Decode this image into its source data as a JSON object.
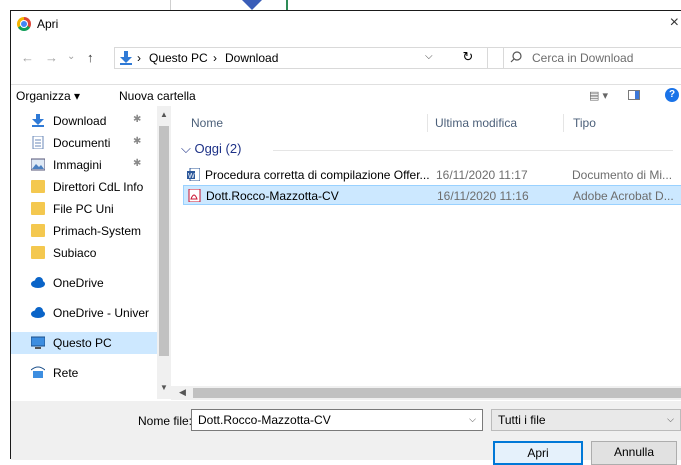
{
  "dialog": {
    "title": "Apri",
    "close_glyph": "×"
  },
  "nav": {
    "back": "←",
    "forward": "→",
    "recent": "⌄",
    "up": "↑",
    "breadcrumb": [
      "Questo PC",
      "Download"
    ],
    "separator": "›",
    "refresh": "↻",
    "search_placeholder": "Cerca in Download"
  },
  "toolbar": {
    "organize": "Organizza ▾",
    "new_folder": "Nuova cartella",
    "views": "▤ ▾",
    "help": "?"
  },
  "navpane": {
    "items": [
      {
        "label": "Download",
        "icon": "download-icon",
        "pinned": true
      },
      {
        "label": "Documenti",
        "icon": "document-icon",
        "pinned": true
      },
      {
        "label": "Immagini",
        "icon": "image-icon",
        "pinned": true
      },
      {
        "label": "Direttori CdL Info",
        "icon": "folder-icon",
        "pinned": false
      },
      {
        "label": "File PC Uni",
        "icon": "folder-icon",
        "pinned": false
      },
      {
        "label": "Primach-System",
        "icon": "folder-icon",
        "pinned": false
      },
      {
        "label": "Subiaco",
        "icon": "folder-icon",
        "pinned": false
      },
      {
        "label": "OneDrive",
        "icon": "cloud-icon",
        "pinned": false
      },
      {
        "label": "OneDrive - Univer",
        "icon": "cloud-icon",
        "pinned": false
      },
      {
        "label": "Questo PC",
        "icon": "computer-icon",
        "pinned": false
      },
      {
        "label": "Rete",
        "icon": "network-icon",
        "pinned": false
      }
    ],
    "pin_glyph": "✱"
  },
  "filelist": {
    "columns": [
      "Nome",
      "Ultima modifica",
      "Tipo"
    ],
    "group_label": "⌵ Oggi (2)",
    "rows": [
      {
        "name": "Procedura corretta di compilazione Offer...",
        "date": "16/11/2020 11:17",
        "type": "Documento di Mi...",
        "icon": "word-icon"
      },
      {
        "name": "Dott.Rocco-Mazzotta-CV",
        "date": "16/11/2020 11:16",
        "type": "Adobe Acrobat D...",
        "icon": "pdf-icon"
      }
    ]
  },
  "bottom": {
    "filename_label": "Nome file:",
    "filename_value": "Dott.Rocco-Mazzotta-CV",
    "filter_value": "Tutti i file",
    "open": "Apri",
    "cancel": "Annulla"
  },
  "colors": {
    "selection": "#cce8ff",
    "accent": "#0078d7",
    "folder": "#f4c84f"
  }
}
